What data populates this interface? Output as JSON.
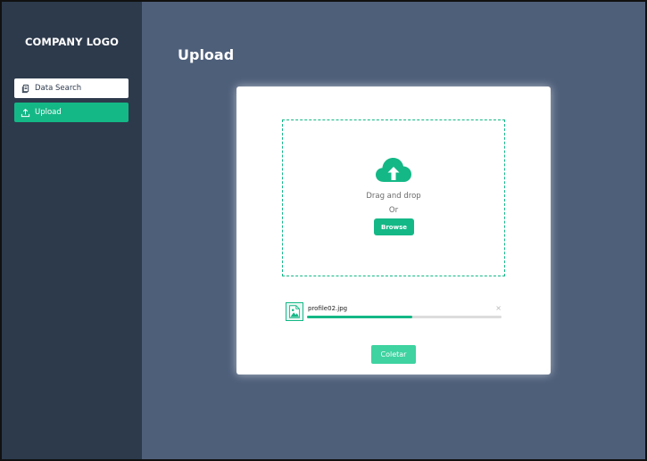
{
  "sidebar": {
    "logo": "COMPANY LOGO",
    "items": [
      {
        "label": "Data Search",
        "icon": "clipboard-copy-icon",
        "active": false
      },
      {
        "label": "Upload",
        "icon": "upload-icon",
        "active": true
      }
    ]
  },
  "main": {
    "title": "Upload"
  },
  "dropzone": {
    "icon": "cloud-upload-icon",
    "drag_text": "Drag and drop",
    "or_text": "Or",
    "browse_label": "Browse"
  },
  "file": {
    "name": "profile02.jpg",
    "icon": "image-file-icon",
    "close_symbol": "×",
    "progress": 0.54
  },
  "actions": {
    "collect_label": "Coletar"
  },
  "colors": {
    "accent": "#14b886",
    "accent_light": "#3ed3a0",
    "sidebar_bg": "#2d3a4c",
    "main_bg": "#4e5f7a"
  }
}
